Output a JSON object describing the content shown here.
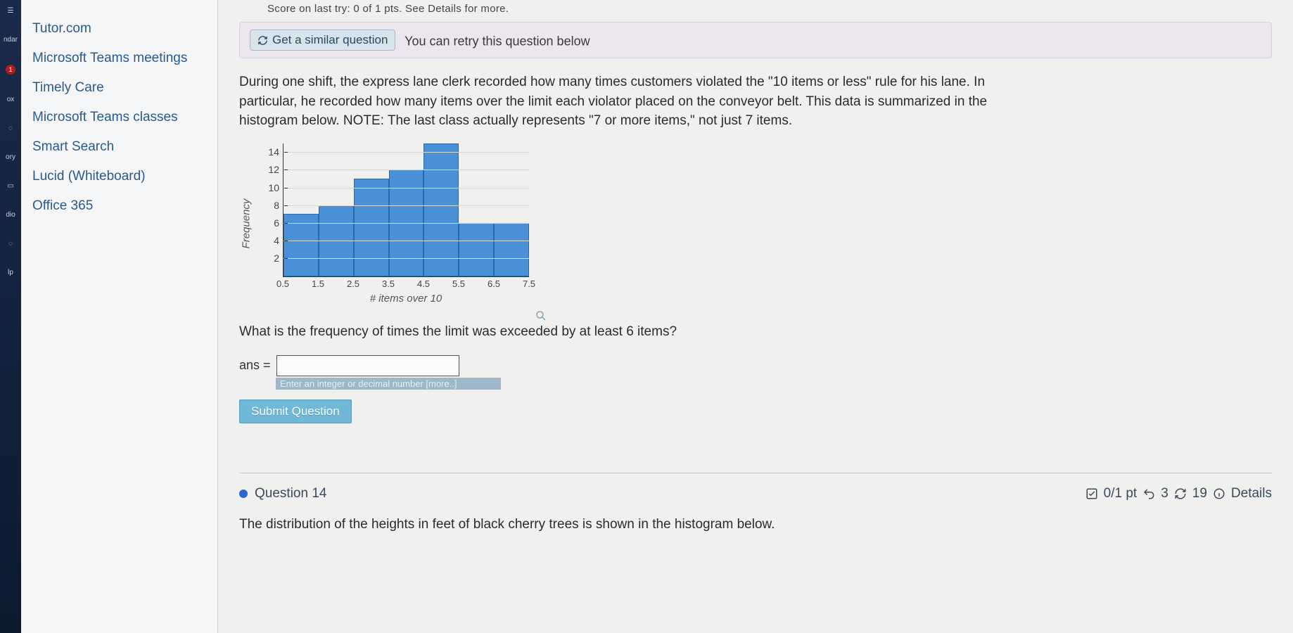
{
  "left_rail": {
    "items": [
      "",
      "ndar",
      "",
      "ox",
      "",
      "ory",
      "",
      "dio",
      "",
      "lp"
    ],
    "badge": "1"
  },
  "sidebar": {
    "links": [
      "Tutor.com",
      "Microsoft Teams meetings",
      "Timely Care",
      "Microsoft Teams classes",
      "Smart Search",
      "Lucid (Whiteboard)",
      "Office 365"
    ]
  },
  "top_cut": "Score on last try: 0 of 1 pts. See Details for more.",
  "retry": {
    "button": "Get a similar question",
    "text": "You can retry this question below"
  },
  "question_text": "During one shift, the express lane clerk recorded how many times customers violated the \"10 items or less\" rule for his lane. In particular, he recorded how many items over the limit each violator placed on the conveyor belt. This data is summarized in the histogram below. NOTE: The last class actually represents \"7 or more items,\" not just 7 items.",
  "chart_data": {
    "type": "bar",
    "title": "",
    "xlabel": "# items over 10",
    "ylabel": "Frequency",
    "ylim": [
      0,
      15
    ],
    "yticks": [
      2,
      4,
      6,
      8,
      10,
      12,
      14
    ],
    "xticks": [
      "0.5",
      "1.5",
      "2.5",
      "3.5",
      "4.5",
      "5.5",
      "6.5",
      "7.5"
    ],
    "categories": [
      1,
      2,
      3,
      4,
      5,
      6,
      7
    ],
    "values": [
      7,
      8,
      11,
      12,
      15,
      6,
      6
    ]
  },
  "sub_question": "What is the frequency of times the limit was exceeded by at least 6 items?",
  "answer": {
    "label": "ans =",
    "value": "",
    "hint": "Enter an integer or decimal number [more..]"
  },
  "submit_label": "Submit Question",
  "footer": {
    "question_label": "Question 14",
    "score": "0/1 pt",
    "retries": "3",
    "attempts": "19",
    "details": "Details"
  },
  "next_question_text": "The distribution of the heights in feet of black cherry trees is shown in the histogram below."
}
